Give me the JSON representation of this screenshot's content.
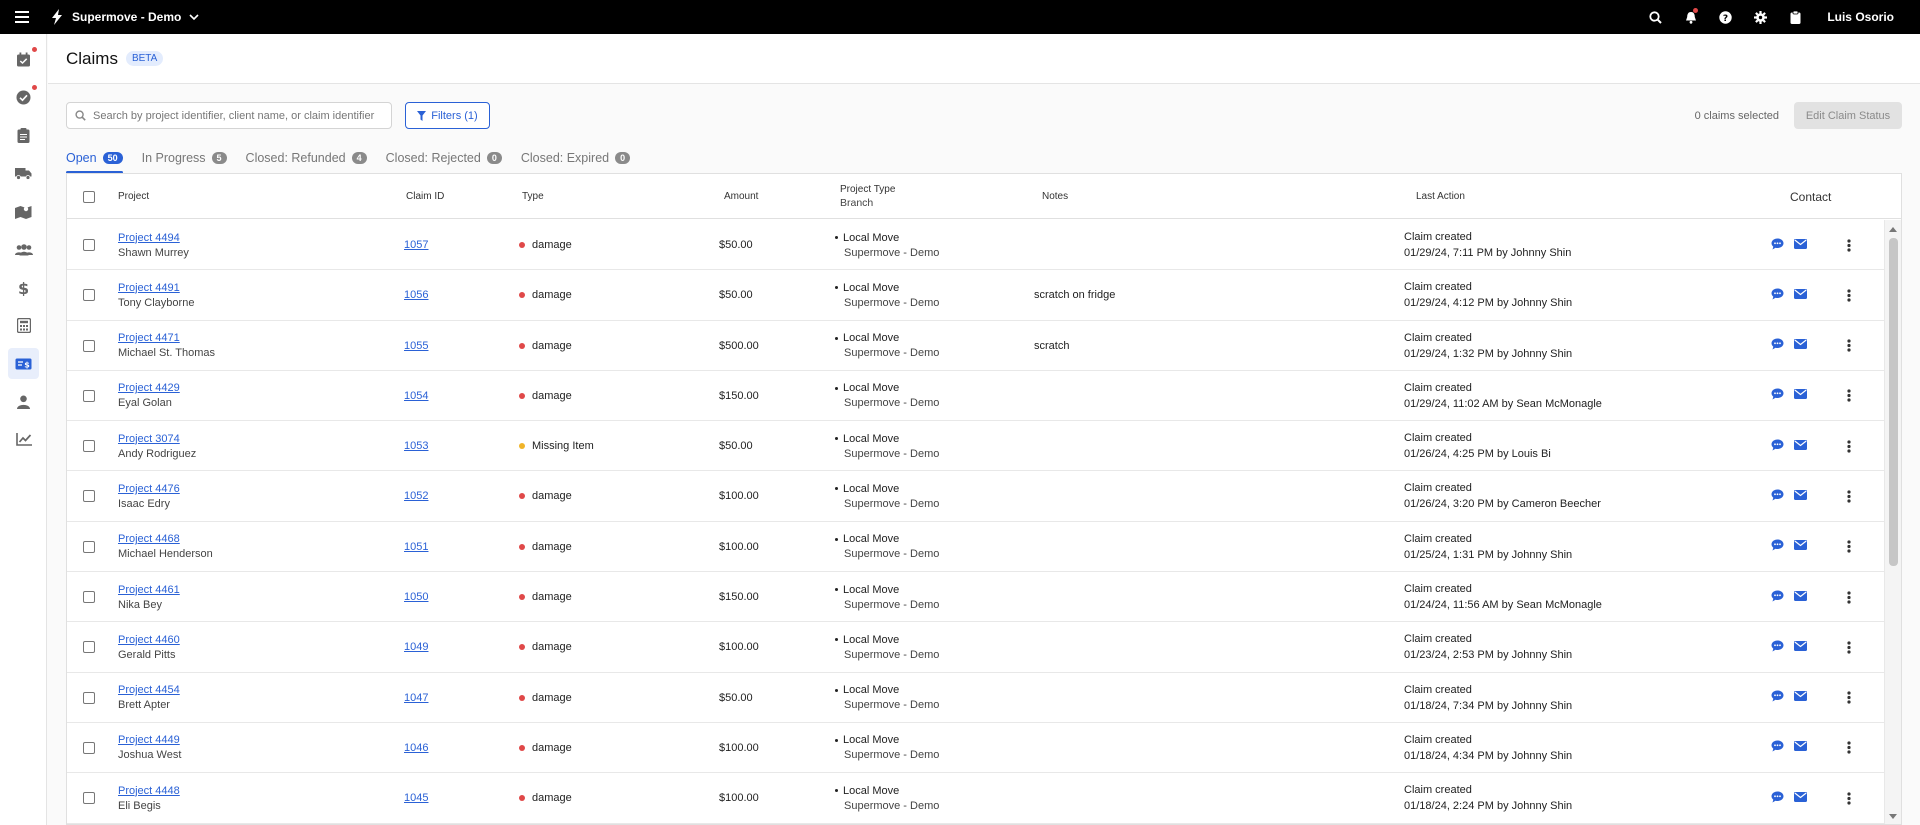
{
  "topbar": {
    "org_name": "Supermove - Demo",
    "user_name": "Luis Osorio",
    "icons": [
      "menu-icon",
      "search-icon",
      "bell-icon",
      "help-icon",
      "gear-icon",
      "clipboard-icon"
    ]
  },
  "sidebar": {
    "items": [
      {
        "icon": "calendar-check-icon",
        "badge": true
      },
      {
        "icon": "check-circle-icon",
        "badge": true
      },
      {
        "icon": "clipboard-list-icon",
        "badge": false
      },
      {
        "icon": "truck-icon",
        "badge": false
      },
      {
        "icon": "map-route-icon",
        "badge": false
      },
      {
        "icon": "users-icon",
        "badge": false
      },
      {
        "icon": "dollar-icon",
        "badge": false
      },
      {
        "icon": "calculator-icon",
        "badge": false
      },
      {
        "icon": "claims-icon",
        "badge": false,
        "active": true
      },
      {
        "icon": "person-icon",
        "badge": false
      },
      {
        "icon": "chart-icon",
        "badge": false
      }
    ]
  },
  "header": {
    "title": "Claims",
    "badge": "BETA"
  },
  "toolbar": {
    "search_placeholder": "Search by project identifier, client name, or claim identifier",
    "filters_label": "Filters (1)",
    "selected_text": "0 claims selected",
    "edit_status_label": "Edit Claim Status"
  },
  "tabs": [
    {
      "label": "Open",
      "count": "50",
      "active": true
    },
    {
      "label": "In Progress",
      "count": "5",
      "active": false
    },
    {
      "label": "Closed: Refunded",
      "count": "4",
      "active": false
    },
    {
      "label": "Closed: Rejected",
      "count": "0",
      "active": false
    },
    {
      "label": "Closed: Expired",
      "count": "0",
      "active": false
    }
  ],
  "columns": {
    "project": "Project",
    "claim_id": "Claim ID",
    "type": "Type",
    "amount": "Amount",
    "project_type": "Project Type",
    "branch": "Branch",
    "notes": "Notes",
    "last_action": "Last Action",
    "contact": "Contact"
  },
  "colors": {
    "accent": "#2a61d6",
    "damage": "#e04848",
    "missing_item": "#f0b429"
  },
  "rows": [
    {
      "project": "Project 4494",
      "client": "Shawn Murrey",
      "claim_id": "1057",
      "type": "damage",
      "amount": "$50.00",
      "project_type": "Local Move",
      "branch": "Supermove - Demo",
      "notes": "",
      "action": "Claim created",
      "action_detail": "01/29/24, 7:11 PM by Johnny Shin"
    },
    {
      "project": "Project 4491",
      "client": "Tony Clayborne",
      "claim_id": "1056",
      "type": "damage",
      "amount": "$50.00",
      "project_type": "Local Move",
      "branch": "Supermove - Demo",
      "notes": "scratch on fridge",
      "action": "Claim created",
      "action_detail": "01/29/24, 4:12 PM by Johnny Shin"
    },
    {
      "project": "Project 4471",
      "client": "Michael St. Thomas",
      "claim_id": "1055",
      "type": "damage",
      "amount": "$500.00",
      "project_type": "Local Move",
      "branch": "Supermove - Demo",
      "notes": "scratch",
      "action": "Claim created",
      "action_detail": "01/29/24, 1:32 PM by Johnny Shin"
    },
    {
      "project": "Project 4429",
      "client": "Eyal Golan",
      "claim_id": "1054",
      "type": "damage",
      "amount": "$150.00",
      "project_type": "Local Move",
      "branch": "Supermove - Demo",
      "notes": "",
      "action": "Claim created",
      "action_detail": "01/29/24, 11:02 AM by Sean McMonagle"
    },
    {
      "project": "Project 3074",
      "client": "Andy Rodriguez",
      "claim_id": "1053",
      "type": "Missing Item",
      "amount": "$50.00",
      "project_type": "Local Move",
      "branch": "Supermove - Demo",
      "notes": "",
      "action": "Claim created",
      "action_detail": "01/26/24, 4:25 PM by Louis Bi"
    },
    {
      "project": "Project 4476",
      "client": "Isaac Edry",
      "claim_id": "1052",
      "type": "damage",
      "amount": "$100.00",
      "project_type": "Local Move",
      "branch": "Supermove - Demo",
      "notes": "",
      "action": "Claim created",
      "action_detail": "01/26/24, 3:20 PM by Cameron Beecher"
    },
    {
      "project": "Project 4468",
      "client": "Michael Henderson",
      "claim_id": "1051",
      "type": "damage",
      "amount": "$100.00",
      "project_type": "Local Move",
      "branch": "Supermove - Demo",
      "notes": "",
      "action": "Claim created",
      "action_detail": "01/25/24, 1:31 PM by Johnny Shin"
    },
    {
      "project": "Project 4461",
      "client": "Nika Bey",
      "claim_id": "1050",
      "type": "damage",
      "amount": "$150.00",
      "project_type": "Local Move",
      "branch": "Supermove - Demo",
      "notes": "",
      "action": "Claim created",
      "action_detail": "01/24/24, 11:56 AM by Sean McMonagle"
    },
    {
      "project": "Project 4460",
      "client": "Gerald Pitts",
      "claim_id": "1049",
      "type": "damage",
      "amount": "$100.00",
      "project_type": "Local Move",
      "branch": "Supermove - Demo",
      "notes": "",
      "action": "Claim created",
      "action_detail": "01/23/24, 2:53 PM by Johnny Shin"
    },
    {
      "project": "Project 4454",
      "client": "Brett Apter",
      "claim_id": "1047",
      "type": "damage",
      "amount": "$50.00",
      "project_type": "Local Move",
      "branch": "Supermove - Demo",
      "notes": "",
      "action": "Claim created",
      "action_detail": "01/18/24, 7:34 PM by Johnny Shin"
    },
    {
      "project": "Project 4449",
      "client": "Joshua West",
      "claim_id": "1046",
      "type": "damage",
      "amount": "$100.00",
      "project_type": "Local Move",
      "branch": "Supermove - Demo",
      "notes": "",
      "action": "Claim created",
      "action_detail": "01/18/24, 4:34 PM by Johnny Shin"
    },
    {
      "project": "Project 4448",
      "client": "Eli Begis",
      "claim_id": "1045",
      "type": "damage",
      "amount": "$100.00",
      "project_type": "Local Move",
      "branch": "Supermove - Demo",
      "notes": "",
      "action": "Claim created",
      "action_detail": "01/18/24, 2:24 PM by Johnny Shin"
    }
  ]
}
